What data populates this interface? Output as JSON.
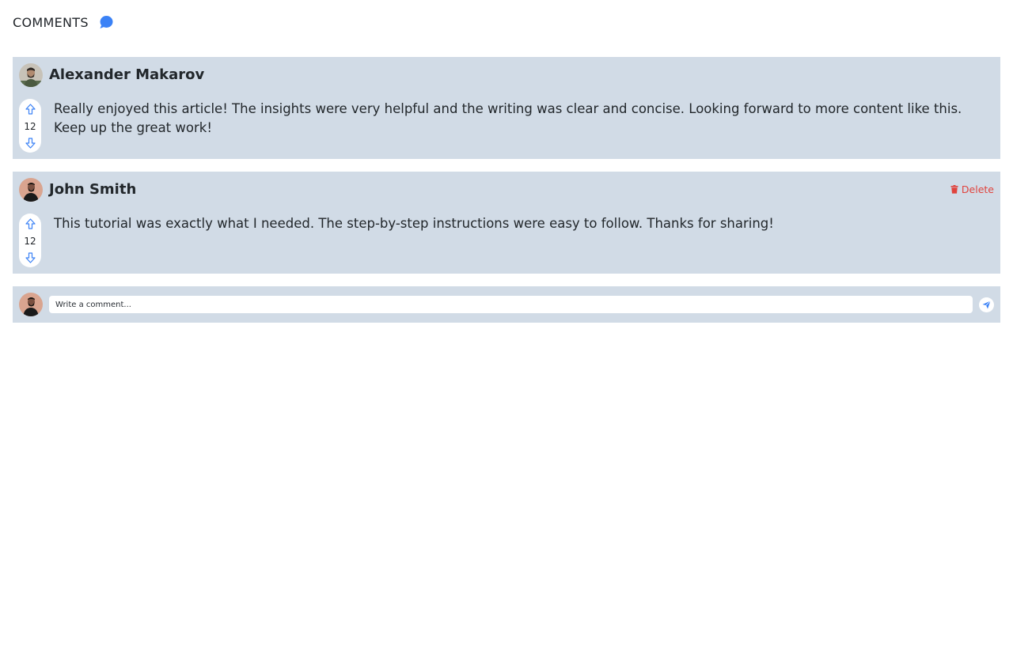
{
  "header": {
    "title": "COMMENTS",
    "icon": "chat-bubble-icon",
    "accent_color": "#3b82f6"
  },
  "comments": [
    {
      "author": "Alexander Makarov",
      "avatar": "avatar-alexander",
      "votes": "12",
      "text": "Really enjoyed this article! The insights were very helpful and the writing was clear and concise. Looking forward to more content like this. Keep up the great work!",
      "can_delete": false
    },
    {
      "author": "John Smith",
      "avatar": "avatar-john",
      "votes": "12",
      "text": "This tutorial was exactly what I needed. The step-by-step instructions were easy to follow. Thanks for sharing!",
      "can_delete": true,
      "delete_label": "Delete"
    }
  ],
  "composer": {
    "placeholder": "Write a comment...",
    "send_icon": "paper-plane-icon"
  },
  "colors": {
    "card_bg": "#d1dbe6",
    "delete": "#e0433d",
    "vote_arrow": "#3b82f6"
  }
}
